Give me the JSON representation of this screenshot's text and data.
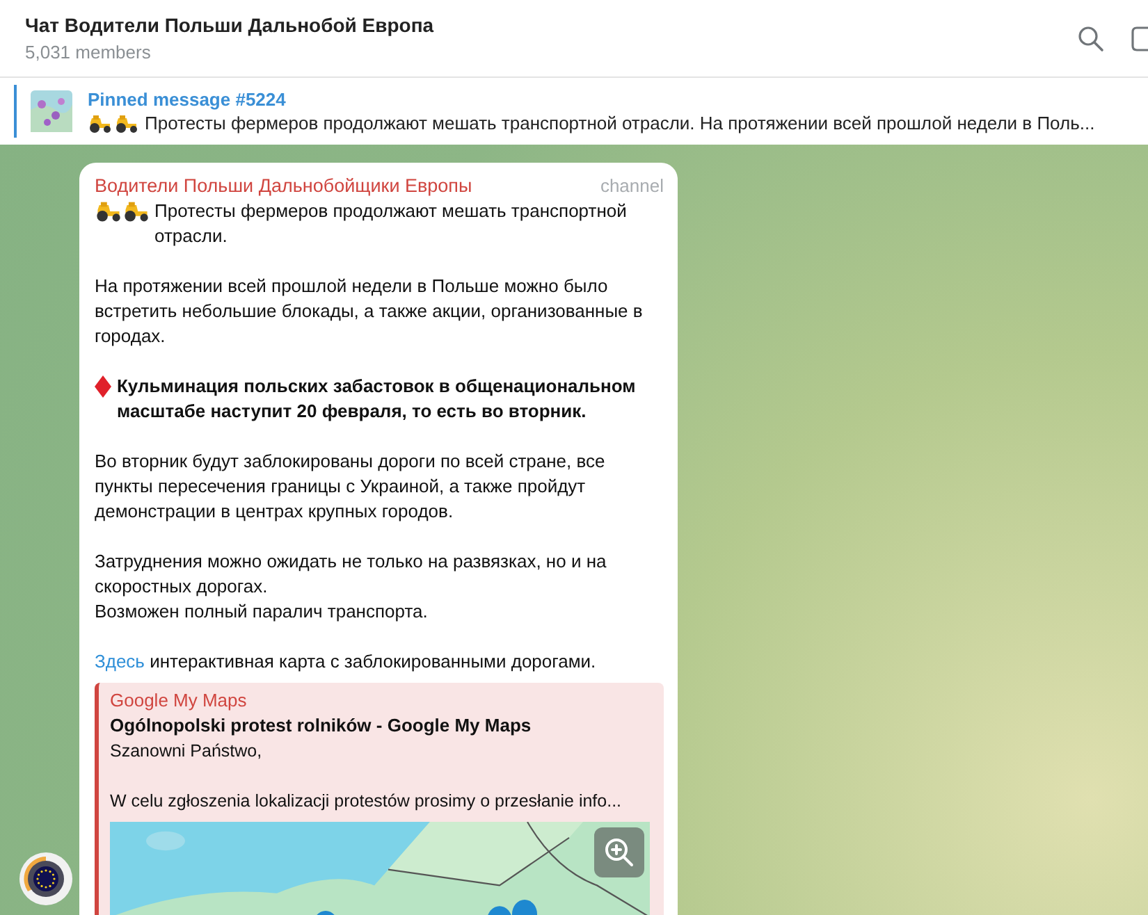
{
  "chat": {
    "title": "Чат Водители Польши Дальнобой Европа",
    "members": "5,031 members"
  },
  "pinned": {
    "label": "Pinned message #5224",
    "text": "Протесты фермеров продолжают мешать транспортной отрасли.  На протяжении всей прошлой недели в Поль..."
  },
  "message": {
    "sender": "Водители Польши Дальнобойщики Европы",
    "badge": "channel",
    "paragraphs": [
      {
        "kind": "lead",
        "text": "Протесты фермеров продолжают мешать транспортной отрасли."
      },
      {
        "kind": "plain",
        "text": "На протяжении всей прошлой недели в Польше можно было встретить небольшие блокады, а также акции, организованные в городах."
      },
      {
        "kind": "alert",
        "text": "Кульминация польских забастовок в общенациональном масштабе наступит 20 февраля, то есть во вторник."
      },
      {
        "kind": "plain",
        "text": "Во вторник будут заблокированы дороги по всей стране, все пункты пересечения границы с Украиной, а также пройдут демонстрации в центрах крупных городов."
      },
      {
        "kind": "plain",
        "text": "Затруднения можно ожидать не только на развязках, но и на скоростных дорогах.\nВозможен полный паралич транспорта."
      },
      {
        "kind": "link",
        "link": "Здесь",
        "text": " интерактивная карта с заблокированными дорогами."
      }
    ],
    "preview": {
      "site": "Google My Maps",
      "title": "Ogólnopolski protest rolników - Google My Maps",
      "description": "Szanowni Państwo,\n\nW celu zgłoszenia lokalizacji protestów prosimy o przesłanie info..."
    }
  }
}
